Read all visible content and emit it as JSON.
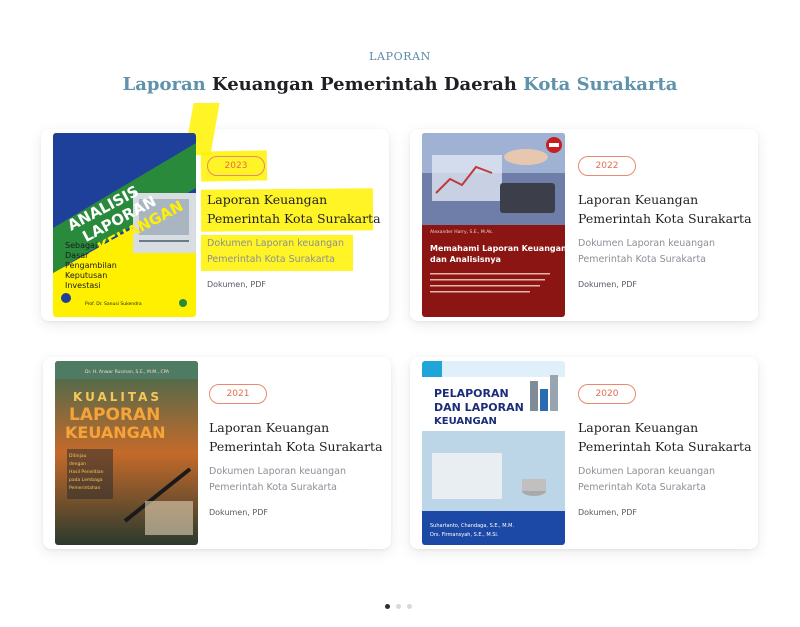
{
  "header": {
    "eyebrow": "LAPORAN",
    "title_part1": "Laporan",
    "title_part2": " Keuangan Pemerintah Daerah ",
    "title_part3": "Kota Surakarta"
  },
  "cards": [
    {
      "year": "2023",
      "title": "Laporan Keuangan Pemerintah Kota Surakarta",
      "description": "Dokumen Laporan keuangan Pemerintah Kota Surakarta",
      "meta": "Dokumen, PDF",
      "cover": {
        "line1": "ANALISIS",
        "line2": "LAPORAN",
        "line3": "KEUANGAN",
        "subtitle1": "Sebagai",
        "subtitle2": "Dasar",
        "subtitle3": "Pengambilan",
        "subtitle4": "Keputusan",
        "subtitle5": "Investasi",
        "author": "Prof. Dr. Sanusi Sukendra"
      }
    },
    {
      "year": "2022",
      "title": "Laporan Keuangan Pemerintah Kota Surakarta",
      "description": "Dokumen Laporan keuangan Pemerintah Kota Surakarta",
      "meta": "Dokumen, PDF",
      "cover": {
        "author": "Alexander Harry, S.E., M.Ak.",
        "title1": "Memahami Laporan Keuangan",
        "title2": "dan Analisisnya"
      }
    },
    {
      "year": "2021",
      "title": "Laporan Keuangan Pemerintah Kota Surakarta",
      "description": "Dokumen Laporan keuangan Pemerintah Kota Surakarta",
      "meta": "Dokumen, PDF",
      "cover": {
        "author": "Dr. H. Anwar Rusman, S.E., M.M., CPA",
        "line1": "KUALITAS",
        "line2": "LAPORAN",
        "line3": "KEUANGAN",
        "note1": "Ditinjau",
        "note2": "dengan",
        "note3": "Hasil Penelitian",
        "note4": "pada Lembaga",
        "note5": "Pemerintahan"
      }
    },
    {
      "year": "2020",
      "title": "Laporan Keuangan Pemerintah Kota Surakarta",
      "description": "Dokumen Laporan keuangan Pemerintah Kota Surakarta",
      "meta": "Dokumen, PDF",
      "cover": {
        "line1": "PELAPORAN",
        "line2": "DAN LAPORAN",
        "line3": "KEUANGAN",
        "author1": "Suhartanto, Chandaga, S.E., M.M.",
        "author2": "Drs. Firmansyah, S.E., M.Si."
      }
    }
  ],
  "pagination": {
    "total": 3,
    "active": 1
  },
  "colors": {
    "accent": "#5f92ab",
    "badge": "#e46c4d",
    "highlight": "#fff200"
  }
}
